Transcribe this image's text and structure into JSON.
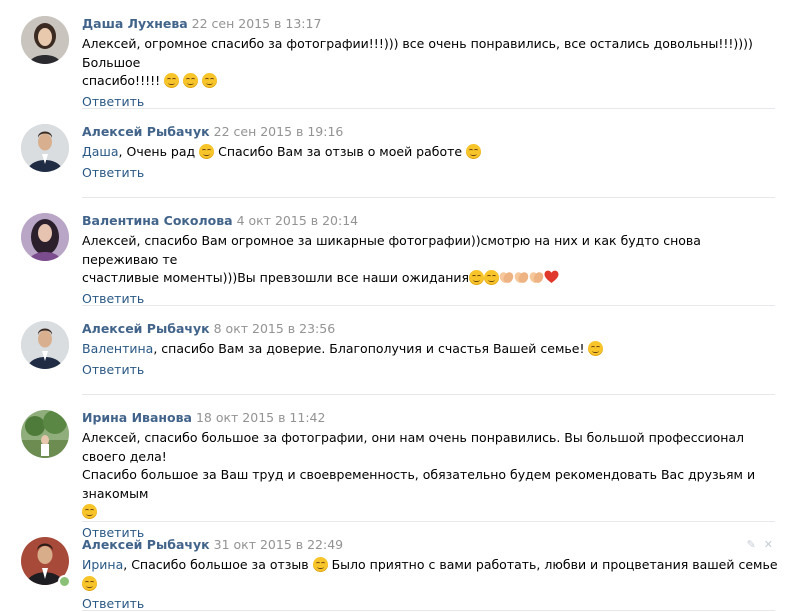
{
  "comments": [
    {
      "author": "Даша Лухнева",
      "date": "22 сен 2015 в 13:17",
      "addressee": "",
      "text1": "Алексей, огромное спасибо за фотографии!!!))) все очень понравились, все остались довольны!!!)))) Большое",
      "text2": "спасибо!!!!! ",
      "reply": "Ответить"
    },
    {
      "author": "Алексей Рыбачук",
      "date": "22 сен 2015 в 19:16",
      "addressee": "Даша",
      "text1": ", Очень рад ",
      "text2": " Спасибо Вам за отзыв о моей работе ",
      "reply": "Ответить"
    },
    {
      "author": "Валентина Соколова",
      "date": "4 окт 2015 в 20:14",
      "addressee": "",
      "text1": "Алексей, спасибо Вам огромное за шикарные фотографии))смотрю на них и как будто снова переживаю те",
      "text2": "счастливые моменты)))Вы превзошли все наши ожидания",
      "reply": "Ответить"
    },
    {
      "author": "Алексей Рыбачук",
      "date": "8 окт 2015 в 23:56",
      "addressee": "Валентина",
      "text1": ", спасибо Вам за доверие. Благополучия и счастья Вашей семье! ",
      "text2": "",
      "reply": "Ответить"
    },
    {
      "author": "Ирина Иванова",
      "date": "18 окт 2015 в 11:42",
      "addressee": "",
      "text1": "Алексей, спасибо большое за фотографии, они нам очень понравились. Вы большой профессионал своего дела!",
      "text2": "Спасибо большое за Ваш труд и своевременность, обязательно будем рекомендовать Вас друзьям и знакомым",
      "reply": "Ответить"
    },
    {
      "author": "Алексей Рыбачук",
      "date": "31 окт 2015 в 22:49",
      "addressee": "Ирина",
      "text1": ", Спасибо большое за отзыв ",
      "text2": " Было приятно с вами работать, любви и процветания вашей семье ",
      "reply": "Ответить"
    }
  ],
  "icons": {
    "emoji": "smiling-face-emoji",
    "clap": "clapping-hands-emoji",
    "heart": "red-heart-emoji",
    "edit": "pencil-icon",
    "delete": "close-icon"
  },
  "colors": {
    "author": "#42648b",
    "link": "#2a5885",
    "date": "#939393",
    "divider": "#e7e8ec",
    "online": "#8ac176"
  }
}
